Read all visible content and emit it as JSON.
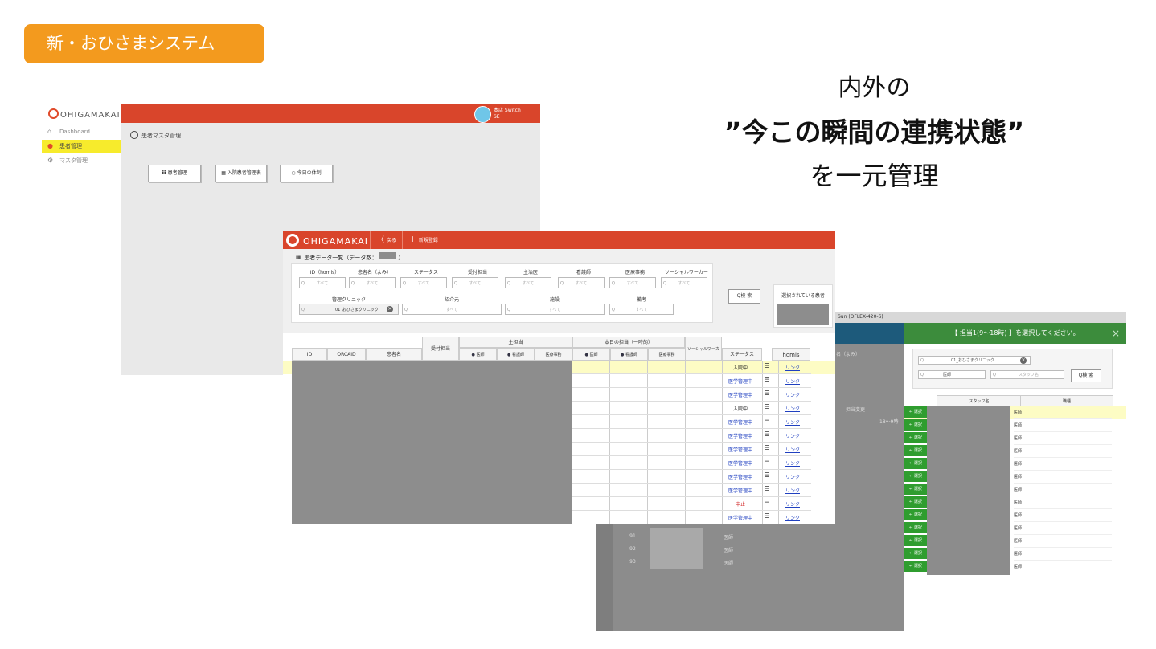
{
  "tag": "新・おひさまシステム",
  "headline": {
    "line1": "内外の",
    "line2": "”今この瞬間の連携状態”",
    "line3": "を一元管理"
  },
  "screen1": {
    "logo": "OHIGAMAKAI",
    "nav": [
      "Dashboard",
      "患者管理",
      "マスタ管理"
    ],
    "user": {
      "line1": "本店 Switch",
      "line2": "SE"
    },
    "breadcrumb": "患者マスタ管理",
    "buttons": [
      "患者管理",
      "入院患者管理表",
      "今日の体制"
    ]
  },
  "screen2": {
    "logo": "OHIGAMAKAI",
    "back": "戻る",
    "new": "新規登録",
    "title_prefix": "患者データ一覧（データ数：",
    "title_suffix": "）",
    "filters": {
      "labels": [
        "ID（homis）",
        "患者名（よみ）",
        "ステータス",
        "受付担当",
        "主治医",
        "看護師",
        "医療事務",
        "ソーシャルワーカー"
      ],
      "placeholder": "すべて",
      "labels2": [
        "管理クリニック",
        "紹介元",
        "施設",
        "備考"
      ],
      "clinic_value": "01_おひさまクリニック"
    },
    "search": "検 索",
    "selected_label": "選択されている患者",
    "table": {
      "headers": [
        "ID",
        "ORCAID",
        "患者名",
        "受付担当",
        "主担当",
        "本日の担当（一時的）",
        "ソーシャルワーカー",
        "ステータス",
        "homis"
      ],
      "sub": [
        "医師",
        "看護師",
        "医療事務"
      ],
      "rows": [
        {
          "status": "入院中",
          "link": "リンク"
        },
        {
          "status": "医学管理中",
          "link": "リンク"
        },
        {
          "status": "医学管理中",
          "link": "リンク"
        },
        {
          "status": "入院中",
          "link": "リンク"
        },
        {
          "status": "医学管理中",
          "link": "リンク"
        },
        {
          "status": "医学管理中",
          "link": "リンク"
        },
        {
          "status": "医学管理中",
          "link": "リンク"
        },
        {
          "status": "医学管理中",
          "link": "リンク"
        },
        {
          "status": "医学管理中",
          "link": "リンク"
        },
        {
          "status": "医学管理中",
          "link": "リンク"
        },
        {
          "status": "中止",
          "link": "リンク"
        },
        {
          "status": "医学管理中",
          "link": "リンク"
        }
      ]
    }
  },
  "screen3": {
    "window_title": "Sun (OFLEX-420-6)",
    "bg_header": "担当変更",
    "bg_time": "18〜9時",
    "bg_name": "名（よみ）",
    "bg_rows": [
      {
        "no": "91",
        "role": "医師"
      },
      {
        "no": "92",
        "role": "医師"
      },
      {
        "no": "93",
        "role": "医師"
      }
    ],
    "dialog": {
      "title": "【 担当1(9〜18時) 】を選択してください。",
      "close": "×",
      "clinic": "01_おひさまクリニック",
      "role": "医師",
      "staff_placeholder": "スタッフ名",
      "search": "検 索",
      "col_staff": "スタッフ名",
      "col_role": "職種",
      "select_label": "← 選択",
      "rows": [
        "医師",
        "医師",
        "医師",
        "医師",
        "医師",
        "医師",
        "医師",
        "医師",
        "医師",
        "医師",
        "医師",
        "医師",
        "医師"
      ]
    }
  }
}
